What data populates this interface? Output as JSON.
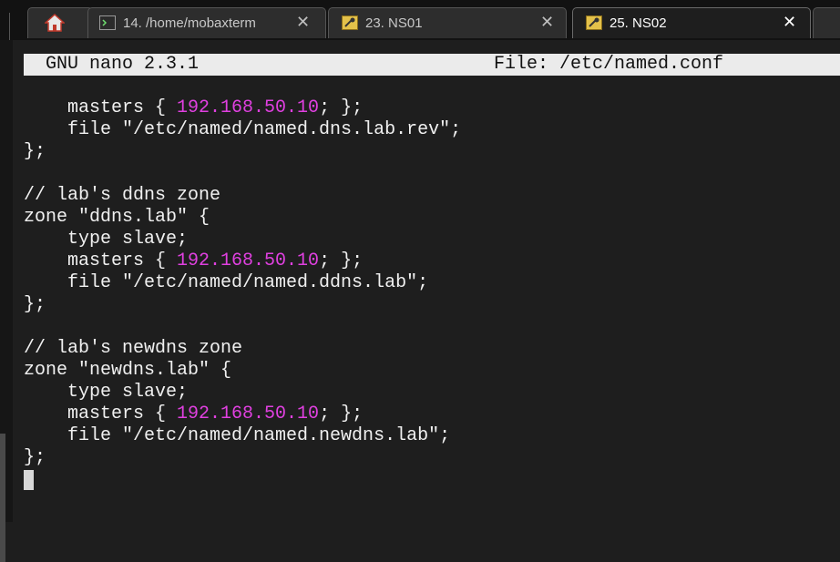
{
  "tabs": [
    {
      "label": "",
      "icon": "home-icon"
    },
    {
      "label": "14. /home/mobaxterm",
      "icon": "terminal-icon"
    },
    {
      "label": "23. NS01",
      "icon": "ssh-key-icon"
    },
    {
      "label": "25. NS02",
      "icon": "ssh-key-icon",
      "active": true
    }
  ],
  "close_glyph": "✕",
  "editor": {
    "name": "GNU nano 2.3.1",
    "file": "File: /etc/named.conf"
  },
  "code": {
    "l1a": "    masters { ",
    "l1ip": "192.168.50.10",
    "l1b": "; };",
    "l2": "    file \"/etc/named/named.dns.lab.rev\";",
    "l3": "};",
    "l5": "// lab's ddns zone",
    "l6": "zone \"ddns.lab\" {",
    "l7": "    type slave;",
    "l8a": "    masters { ",
    "l8ip": "192.168.50.10",
    "l8b": "; };",
    "l9": "    file \"/etc/named/named.ddns.lab\";",
    "l10": "};",
    "l12": "// lab's newdns zone",
    "l13": "zone \"newdns.lab\" {",
    "l14": "    type slave;",
    "l15a": "    masters { ",
    "l15ip": "192.168.50.10",
    "l15b": "; };",
    "l16": "    file \"/etc/named/named.newdns.lab\";",
    "l17": "};"
  },
  "colors": {
    "ip_highlight": "#e040e0",
    "statusbar_bg": "#ebebeb",
    "terminal_bg": "#1e1e1e"
  }
}
